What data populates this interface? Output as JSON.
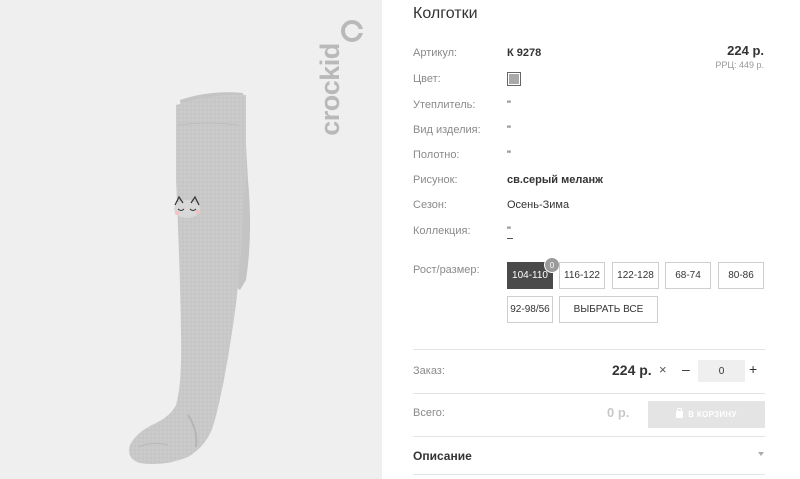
{
  "product": {
    "title": "Колготки",
    "price": "224 р.",
    "rrp": "РРЦ: 449 р."
  },
  "brand_logo": "crockid",
  "attributes": [
    {
      "label": "Артикул:",
      "value": "К 9278"
    },
    {
      "label": "Цвет:",
      "value": ""
    },
    {
      "label": "Утеплитель:",
      "value": "\""
    },
    {
      "label": "Вид изделия:",
      "value": "\""
    },
    {
      "label": "Полотно:",
      "value": "\""
    },
    {
      "label": "Рисунок:",
      "value": "св.серый меланж"
    },
    {
      "label": "Сезон:",
      "value": "Осень-Зима"
    },
    {
      "label": "Коллекция:",
      "value": "\""
    }
  ],
  "color_swatch": "#a9a9a9",
  "sizes": {
    "label": "Рост/размер:",
    "options": [
      "104-110",
      "116-122",
      "122-128",
      "68-74",
      "80-86",
      "92-98/56"
    ],
    "selected": "104-110",
    "selected_count": "0",
    "select_all": "ВЫБРАТЬ ВСЕ"
  },
  "order": {
    "label": "Заказ:",
    "price": "224 р.",
    "multiply": "×",
    "minus": "–",
    "quantity": "0",
    "plus": "+"
  },
  "total": {
    "label": "Всего:",
    "value": "0 р.",
    "cart_button": "В КОРЗИНУ"
  },
  "description": {
    "label": "Описание"
  },
  "icons": [
    "bag-icon",
    "chevron-down-icon",
    "close-icon"
  ]
}
